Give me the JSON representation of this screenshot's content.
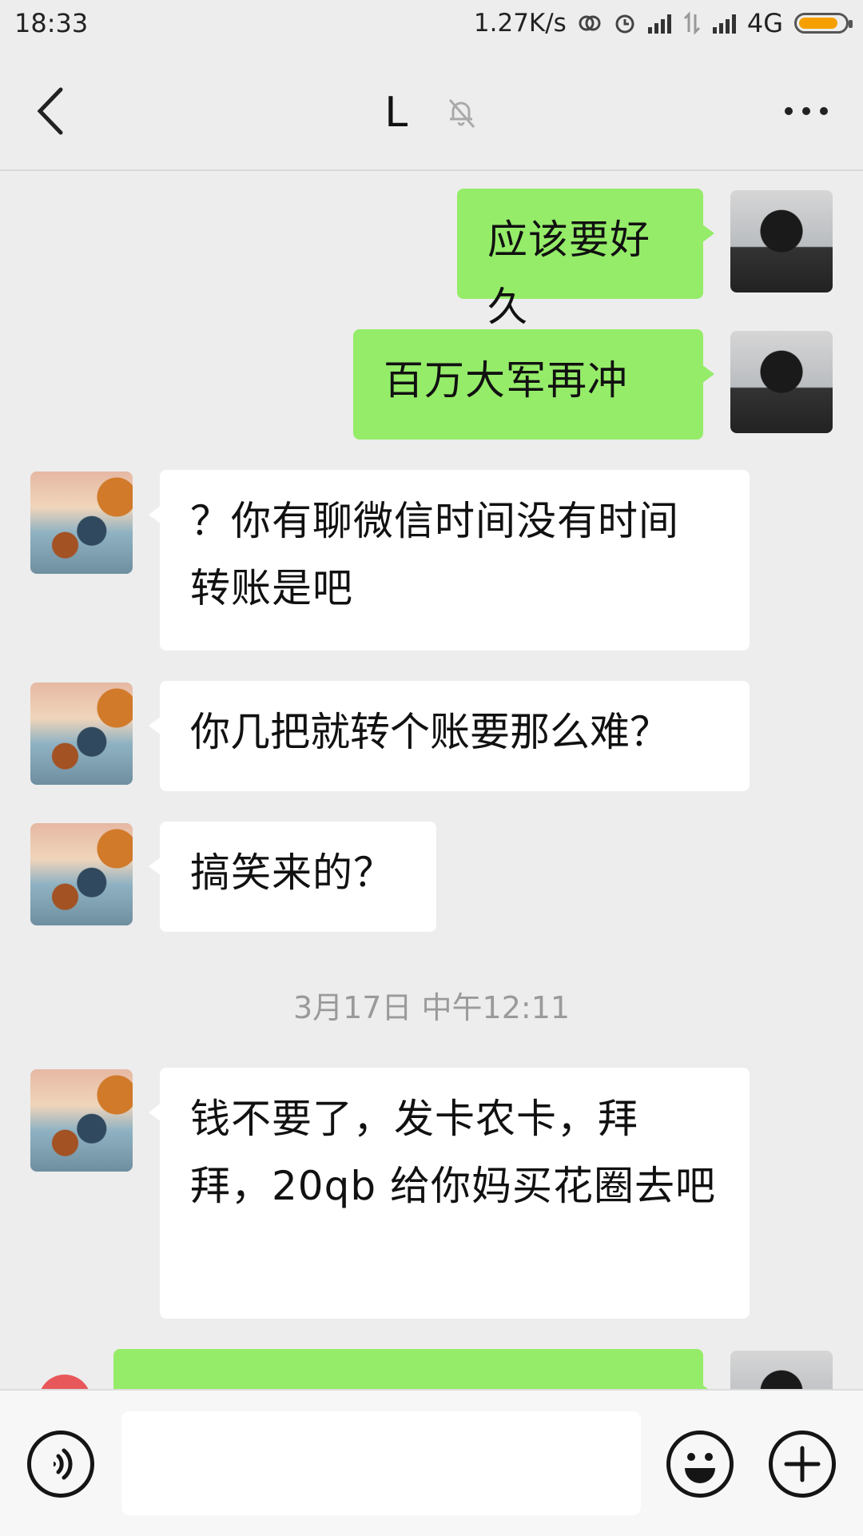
{
  "status_bar": {
    "time": "18:33",
    "network_speed": "1.27K/s",
    "network_type": "4G",
    "battery_color": "#f5a000"
  },
  "header": {
    "title": "L",
    "back_icon": "chevron-left-icon",
    "mute_icon": "bell-muted-icon",
    "more_icon": "more-dots-icon"
  },
  "messages": [
    {
      "side": "right",
      "text": "应该要好久"
    },
    {
      "side": "right",
      "text": "百万大军再冲"
    },
    {
      "side": "left",
      "text": "？你有聊微信时间没有时间转账是吧"
    },
    {
      "side": "left",
      "text": "你几把就转个账要那么难？"
    },
    {
      "side": "left",
      "text": "搞笑来的？"
    },
    {
      "side": "left",
      "text": "钱不要了，发卡农卡，拜拜，20qb 给你妈买花圈去吧"
    }
  ],
  "timestamp": "3月17日 中午12:11",
  "input_bar": {
    "voice_icon": "voice-icon",
    "emoji_icon": "emoji-icon",
    "plus_icon": "plus-icon",
    "text_value": ""
  },
  "colors": {
    "background": "#ededed",
    "sent_bubble": "#95ec69",
    "received_bubble": "#ffffff"
  }
}
